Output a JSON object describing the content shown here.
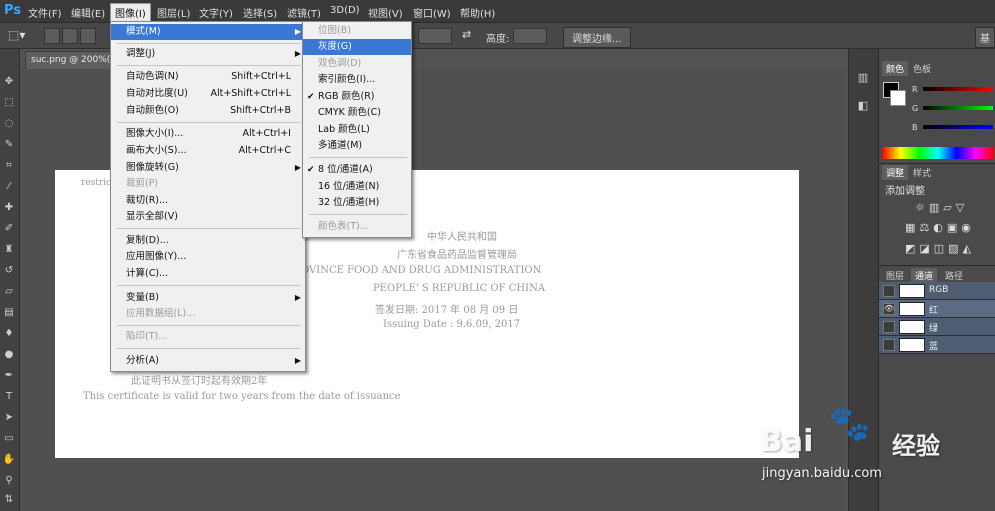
{
  "app": {
    "logo": "Ps"
  },
  "menubar": {
    "items": [
      "文件(F)",
      "编辑(E)",
      "图像(I)",
      "图层(L)",
      "文字(Y)",
      "选择(S)",
      "滤镜(T)",
      "3D(D)",
      "视图(V)",
      "窗口(W)",
      "帮助(H)"
    ]
  },
  "options": {
    "height_label": "高度:",
    "refine_edge_label": "调整边缘...",
    "workspace_label": "基"
  },
  "document": {
    "tab_title": "suc.png @ 200%("
  },
  "certificate": {
    "left_fragment": "restric",
    "line1": "中华人民共和国",
    "line2": "广东省食品药品监督管理局",
    "line3": "OVINCE FOOD AND DRUG ADMINISTRATION",
    "line4": "PEOPLE' S REPUBLIC OF CHINA",
    "line5": "签发日期: 2017 年 08 月 09 日",
    "line6": "Issuing Date : 9.6.09, 2017",
    "line7": "此证明书从签订时起有效期2年",
    "line8": "This certificate is valid for two years from the date of issuance"
  },
  "image_menu": {
    "items": [
      {
        "label": "模式(M)",
        "shortcut": "",
        "submenu": true,
        "disabled": false,
        "highlight": true
      },
      {
        "label": "调整(J)",
        "shortcut": "",
        "submenu": true,
        "disabled": false
      },
      {
        "label": "自动色调(N)",
        "shortcut": "Shift+Ctrl+L",
        "disabled": false
      },
      {
        "label": "自动对比度(U)",
        "shortcut": "Alt+Shift+Ctrl+L",
        "disabled": false
      },
      {
        "label": "自动颜色(O)",
        "shortcut": "Shift+Ctrl+B",
        "disabled": false
      },
      {
        "label": "图像大小(I)...",
        "shortcut": "Alt+Ctrl+I",
        "disabled": false
      },
      {
        "label": "画布大小(S)...",
        "shortcut": "Alt+Ctrl+C",
        "disabled": false
      },
      {
        "label": "图像旋转(G)",
        "shortcut": "",
        "submenu": true,
        "disabled": false
      },
      {
        "label": "裁剪(P)",
        "shortcut": "",
        "disabled": true
      },
      {
        "label": "裁切(R)...",
        "shortcut": "",
        "disabled": false
      },
      {
        "label": "显示全部(V)",
        "shortcut": "",
        "disabled": false
      },
      {
        "label": "复制(D)...",
        "shortcut": "",
        "disabled": false
      },
      {
        "label": "应用图像(Y)...",
        "shortcut": "",
        "disabled": false
      },
      {
        "label": "计算(C)...",
        "shortcut": "",
        "disabled": false
      },
      {
        "label": "变量(B)",
        "shortcut": "",
        "submenu": true,
        "disabled": false
      },
      {
        "label": "应用数据组(L)...",
        "shortcut": "",
        "disabled": true
      },
      {
        "label": "陷印(T)...",
        "shortcut": "",
        "disabled": true
      },
      {
        "label": "分析(A)",
        "shortcut": "",
        "submenu": true,
        "disabled": false
      }
    ]
  },
  "mode_menu": {
    "items": [
      {
        "label": "位图(B)",
        "disabled": true
      },
      {
        "label": "灰度(G)",
        "disabled": false,
        "highlight": true
      },
      {
        "label": "双色调(D)",
        "disabled": true
      },
      {
        "label": "索引颜色(I)...",
        "disabled": false
      },
      {
        "label": "RGB 颜色(R)",
        "disabled": false,
        "checked": true
      },
      {
        "label": "CMYK 颜色(C)",
        "disabled": false
      },
      {
        "label": "Lab 颜色(L)",
        "disabled": false
      },
      {
        "label": "多通道(M)",
        "disabled": false
      },
      {
        "label": "8 位/通道(A)",
        "disabled": false,
        "checked": true
      },
      {
        "label": "16 位/通道(N)",
        "disabled": false
      },
      {
        "label": "32 位/通道(H)",
        "disabled": false
      },
      {
        "label": "颜色表(T)...",
        "disabled": true
      }
    ]
  },
  "color_panel": {
    "tabs": [
      "颜色",
      "色板"
    ],
    "sliders": [
      "R",
      "G",
      "B"
    ]
  },
  "adjustments_panel": {
    "tabs": [
      "调整",
      "样式"
    ],
    "title": "添加调整"
  },
  "channels_panel": {
    "tabs": [
      "图层",
      "通道",
      "路径"
    ],
    "channels": [
      "RGB",
      "红",
      "绿",
      "蓝"
    ]
  },
  "watermark": {
    "brand": "Bai",
    "brand2": "经验",
    "url": "jingyan.baidu.com"
  }
}
